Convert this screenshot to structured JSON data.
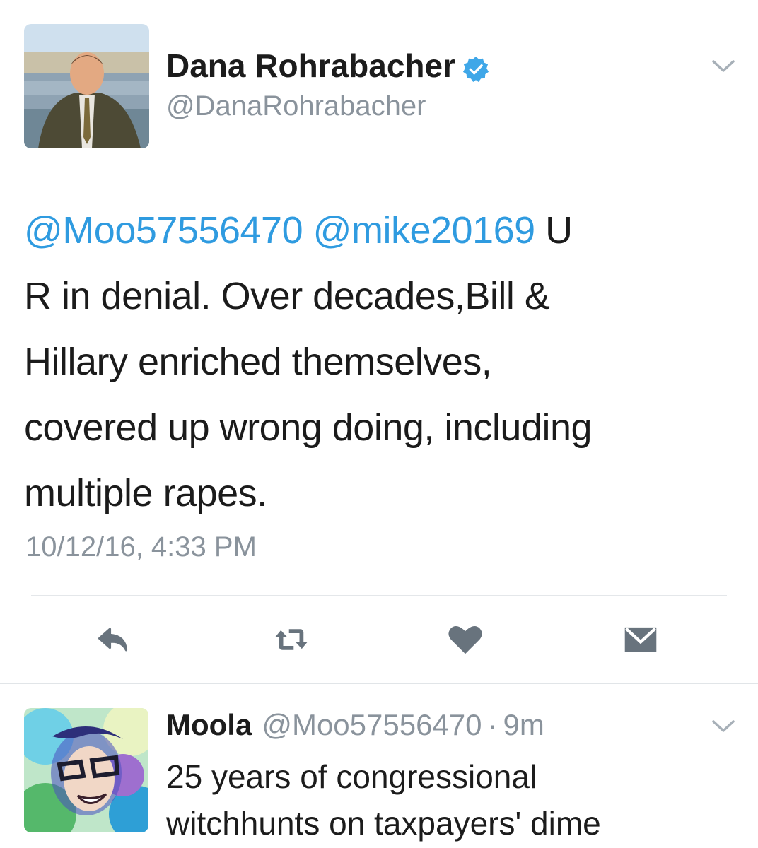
{
  "tweet": {
    "display_name": "Dana Rohrabacher",
    "handle": "@DanaRohrabacher",
    "verified": true,
    "text_lines": [
      {
        "mention1": "@Moo57556470",
        "mention2": "@mike20169",
        "rest": " U"
      },
      {
        "text": "R in denial. Over decades,Bill &"
      },
      {
        "text": "Hillary enriched themselves,"
      },
      {
        "text": "covered up wrong doing, including"
      },
      {
        "text": "multiple rapes."
      }
    ],
    "timestamp": "10/12/16, 4:33 PM",
    "actions": {
      "reply_icon": "reply-icon",
      "retweet_icon": "retweet-icon",
      "like_icon": "heart-icon",
      "dm_icon": "envelope-icon"
    }
  },
  "reply": {
    "display_name": "Moola",
    "handle": "@Moo57556470",
    "separator": "·",
    "time": "9m",
    "text_lines": [
      "25 years of congressional",
      "witchhunts on taxpayers' dime"
    ]
  },
  "colors": {
    "mention": "#2f9be0",
    "verified": "#3fa7e8",
    "secondary_text": "#8a939c",
    "icon": "#68737d"
  }
}
